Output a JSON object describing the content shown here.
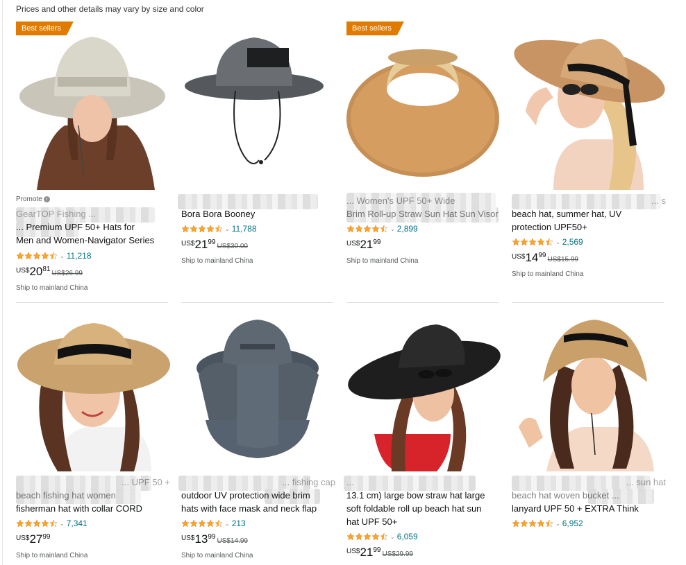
{
  "notice": "Prices and other details may vary by size and color",
  "badge_label": "Best sellers",
  "promote_label": "Promote",
  "ship_label": "Ship to mainland China",
  "accent": "#e07b00",
  "star_color": "#ffa41c",
  "products": [
    {
      "title_lines": [
        "GearTOP Fishing ...",
        "... Premium UPF 50+ Hats for",
        "Men and Women-Navigator Series"
      ],
      "reviews": "11,218",
      "price_sym": "US$",
      "price_whole": "20",
      "price_frac": "81",
      "list_price": "US$26.99",
      "rating": 4.5
    },
    {
      "title_lines": [
        "Bora Bora Booney"
      ],
      "reviews": "11,788",
      "price_sym": "US$",
      "price_whole": "21",
      "price_frac": "99",
      "list_price": "US$30.00",
      "rating": 4.5
    },
    {
      "title_lines": [
        "... Women's UPF 50+ Wide",
        "Brim Roll-up Straw Sun Hat Sun Visor"
      ],
      "reviews": "2,899",
      "price_sym": "US$",
      "price_whole": "21",
      "price_frac": "99",
      "list_price": "",
      "rating": 4.5
    },
    {
      "title_lines": [
        "... s",
        "beach hat, summer hat, UV",
        "protection UPF50+"
      ],
      "reviews": "2,569",
      "price_sym": "US$",
      "price_whole": "14",
      "price_frac": "99",
      "list_price": "US$15.99",
      "rating": 4.5
    },
    {
      "title_lines": [
        "... UPF 50 +",
        "beach fishing hat women",
        "fisherman hat with collar CORD"
      ],
      "reviews": "7,341",
      "price_sym": "US$",
      "price_whole": "27",
      "price_frac": "99",
      "list_price": "",
      "rating": 4.5
    },
    {
      "title_lines": [
        "... fishing cap",
        "outdoor UV protection wide brim",
        "hats with face mask and neck flap"
      ],
      "reviews": "213",
      "price_sym": "US$",
      "price_whole": "13",
      "price_frac": "99",
      "list_price": "US$14.99",
      "rating": 4.5
    },
    {
      "title_lines": [
        "...",
        "13.1 cm) large bow straw hat large",
        "soft foldable roll up beach hat sun",
        "hat UPF 50+"
      ],
      "reviews": "6,059",
      "price_sym": "US$",
      "price_whole": "21",
      "price_frac": "99",
      "list_price": "US$29.99",
      "rating": 4.5
    },
    {
      "title_lines": [
        "... sun hat",
        "beach hat woven bucket ...",
        "lanyard UPF 50 + EXTRA Think"
      ],
      "reviews": "6,952",
      "price_sym": "",
      "price_whole": "",
      "price_frac": "",
      "list_price": "",
      "rating": 4.5
    }
  ]
}
